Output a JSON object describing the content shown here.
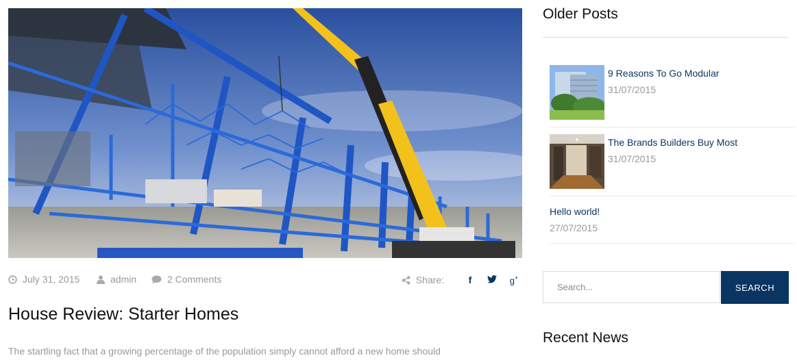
{
  "post": {
    "date": "July 31, 2015",
    "author": "admin",
    "comments": "2 Comments",
    "share_label": "Share:",
    "title": "House Review: Starter Homes",
    "excerpt": "The startling fact that a growing percentage of the population simply cannot afford a new home should"
  },
  "sidebar": {
    "older_posts_heading": "Older Posts",
    "older_posts": [
      {
        "title": "9 Reasons To Go Modular",
        "date": "31/07/2015"
      },
      {
        "title": "The Brands Builders Buy Most",
        "date": "31/07/2015"
      },
      {
        "title": "Hello world!",
        "date": "27/07/2015"
      }
    ],
    "search": {
      "placeholder": "Search...",
      "button_label": "SEARCH"
    },
    "recent_news_heading": "Recent News"
  },
  "colors": {
    "accent": "#0a3462",
    "muted_text": "#999999"
  },
  "icons": {
    "date": "clock-icon",
    "author": "user-icon",
    "comments": "comment-icon",
    "share": "share-icon",
    "social": [
      "facebook-icon",
      "twitter-icon",
      "google-plus-icon"
    ]
  }
}
